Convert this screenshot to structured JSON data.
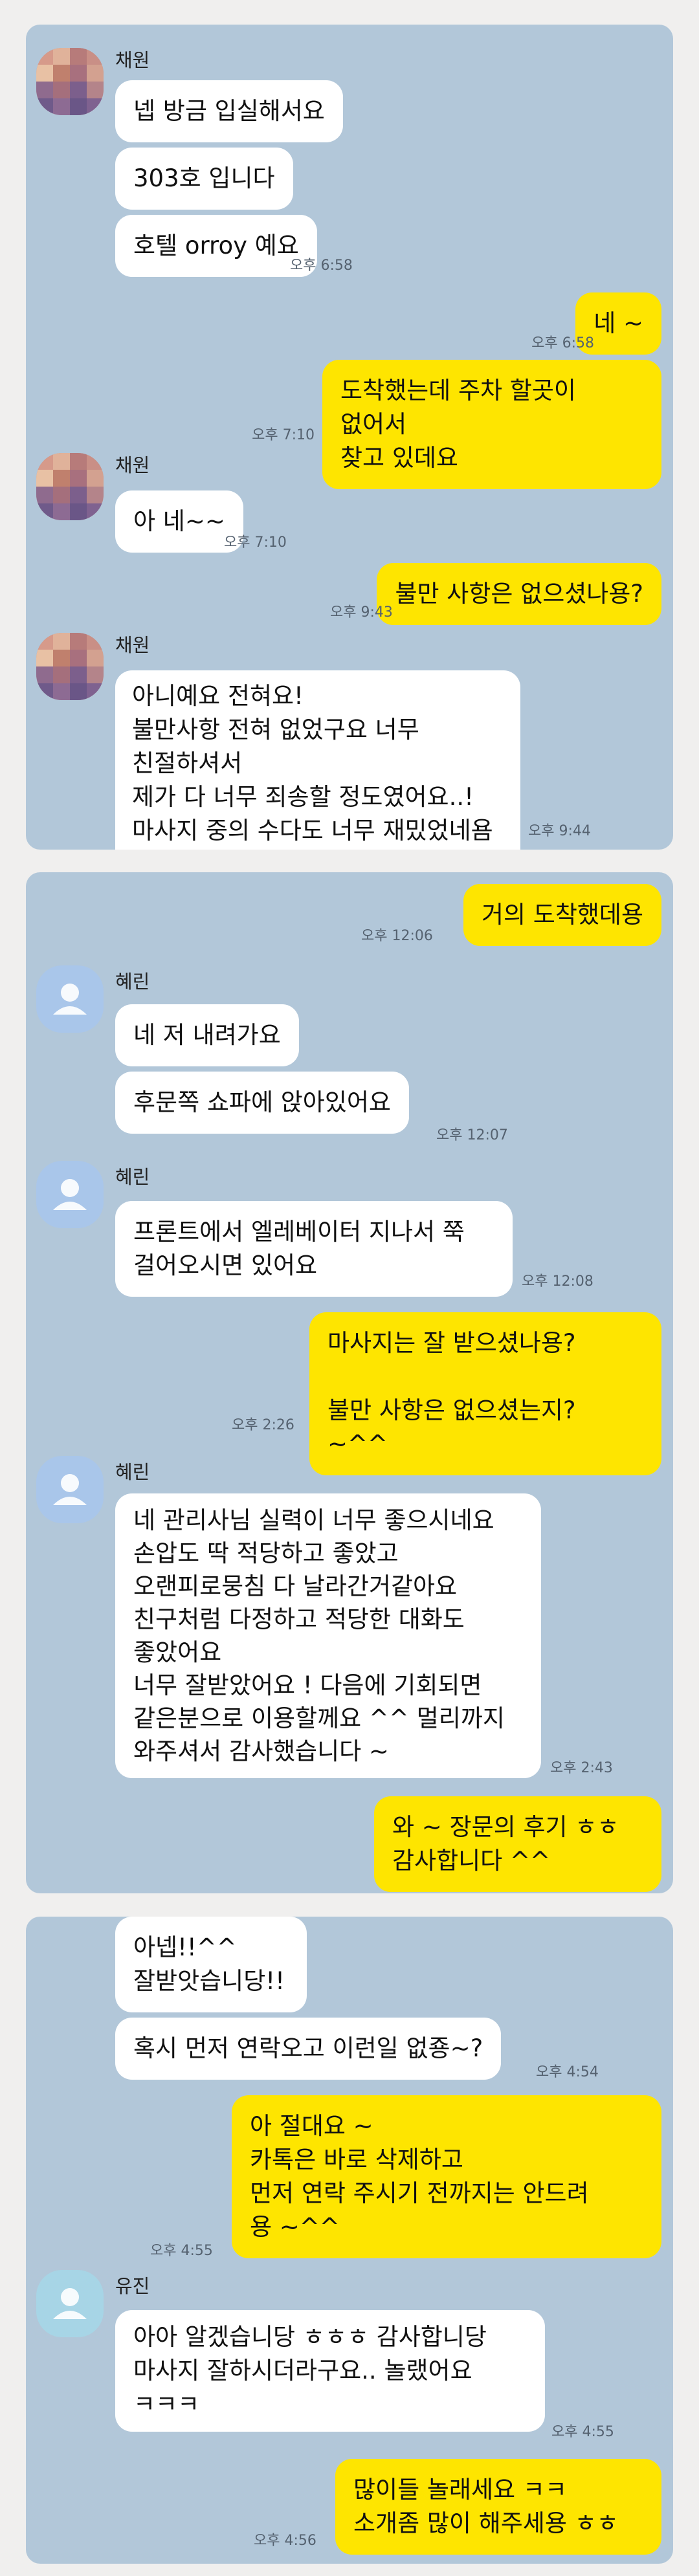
{
  "colors": {
    "chat_bg": "#b2c7d9",
    "my_bubble": "#fee500",
    "their_bubble": "#ffffff",
    "time_text": "#556270"
  },
  "panel1": {
    "sender1": "채원",
    "m1": "넵 방금 입실해서요",
    "m2": "303호 입니다",
    "m3": "호텔 orroy 예요",
    "t1": "오후 6:58",
    "me1": "네 ~",
    "t2": "오후 6:58",
    "me2": "도착했는데  주차 할곳이 없어서\n찾고 있데요",
    "t3": "오후 7:10",
    "sender2": "채원",
    "m4": "아 네~~",
    "t4": "오후 7:10",
    "me3": "불만 사항은 없으셨나용?",
    "t5": "오후 9:43",
    "sender3": "채원",
    "m5": "아니예요 전혀요!\n불만사항 전혀 없었구요 너무 친절하셔서\n제가 다 너무 죄송할 정도였어요..!\n마사지 중의 수다도 너무 재밌었네욤\nㅎㅎㅎ",
    "t6": "오후 9:44"
  },
  "panel2": {
    "me1": "거의 도착했데용",
    "t1": "오후 12:06",
    "sender1": "혜린",
    "m1": "네 저 내려가요",
    "m2": "후문쪽 쇼파에 앉아있어요",
    "t2": "오후 12:07",
    "sender2": "혜린",
    "m3": "프론트에서 엘레베이터 지나서 쭉\n걸어오시면 있어요",
    "t3": "오후 12:08",
    "me2": "마사지는 잘 받으셨나용?\n\n불만 사항은 없으셨는지? ~^^",
    "t4": "오후 2:26",
    "sender3": "혜린",
    "m4": "네 관리사님 실력이 너무 좋으시네요\n손압도 딱 적당하고 좋았고\n오랜피로뭉침 다 날라간거같아요\n친구처럼 다정하고 적당한 대화도\n좋았어요\n너무 잘받았어요 ! 다음에 기회되면\n같은분으로 이용할께요 ^^ 멀리까지\n와주셔서 감사했습니다 ~",
    "t5": "오후 2:43",
    "me3": "와 ~ 장문의 후기 ㅎㅎ\n감사합니다 ^^",
    "t6": ""
  },
  "panel3": {
    "m1": "아넵!!^^\n잘받앗습니당!!",
    "m2": "혹시 먼저 연락오고 이런일 없죵~?",
    "t1": "오후 4:54",
    "me1": "아 절대요 ~\n카톡은 바로 삭제하고\n먼저 연락 주시기 전까지는 안드려\n용 ~^^",
    "t2": "오후 4:55",
    "sender1": "유진",
    "m3": "아아 알겠습니당 ㅎㅎㅎ 감사합니당\n마사지 잘하시더라구요.. 놀랬어요\nㅋㅋㅋ",
    "t3": "오후 4:55",
    "me2": "많이들 놀래세요 ㅋㅋ\n소개좀 많이 해주세용 ㅎㅎ",
    "t4": "오후 4:56"
  },
  "icons": {
    "avatar_photo": "pixelated-photo-avatar",
    "avatar_default": "default-person-avatar"
  }
}
